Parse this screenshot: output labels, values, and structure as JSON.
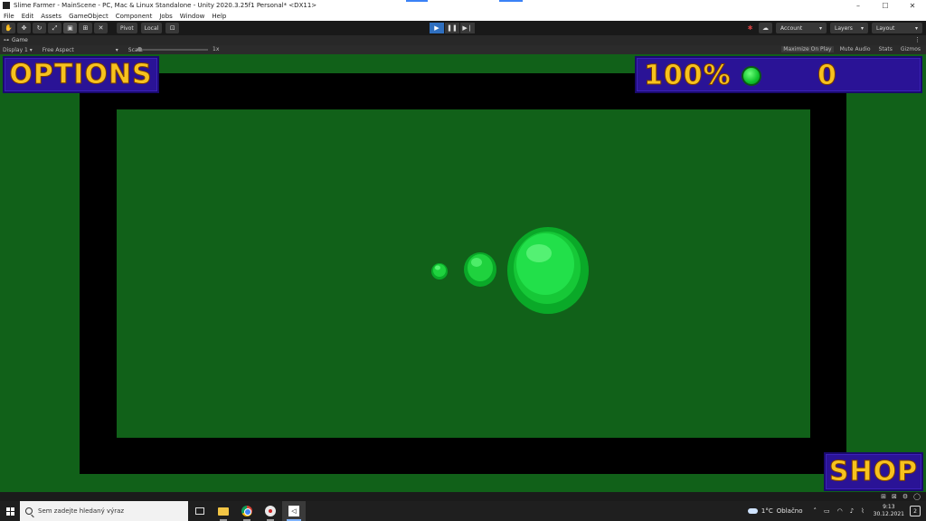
{
  "window": {
    "title": "Slime Farmer - MainScene - PC, Mac & Linux Standalone - Unity 2020.3.25f1 Personal* <DX11>",
    "controls": [
      "–",
      "☐",
      "✕"
    ]
  },
  "menu": [
    "File",
    "Edit",
    "Assets",
    "GameObject",
    "Component",
    "Jobs",
    "Window",
    "Help"
  ],
  "toolbar": {
    "pivot_label": "Pivot",
    "local_label": "Local",
    "account_label": "Account",
    "layers_label": "Layers",
    "layout_label": "Layout"
  },
  "game_tab": {
    "label": "Game"
  },
  "game_bar": {
    "display": "Display 1",
    "aspect": "Free Aspect",
    "scale_label": "Scale",
    "scale_value": "1x",
    "maximize": "Maximize On Play",
    "mute": "Mute Audio",
    "stats": "Stats",
    "gizmos": "Gizmos"
  },
  "hud": {
    "options_label": "OPTIONS",
    "percent": "100%",
    "coins": "0",
    "shop_label": "SHOP"
  },
  "slimes": [
    {
      "size": "small",
      "color": "#1fd23e"
    },
    {
      "size": "medium",
      "color": "#1fd23e"
    },
    {
      "size": "large",
      "color": "#1fd23e"
    }
  ],
  "colors": {
    "grass": "#116119",
    "frame": "#000000",
    "hud_panel": "#2a1396",
    "hud_text": "#f7c21e",
    "play_active": "#2f6fbf"
  },
  "taskbar": {
    "search_placeholder": "Sem zadejte hledaný výraz",
    "weather_temp": "1°C",
    "weather_desc": "Oblačno",
    "time": "9:13",
    "date": "30.12.2021",
    "notifications": "2"
  }
}
